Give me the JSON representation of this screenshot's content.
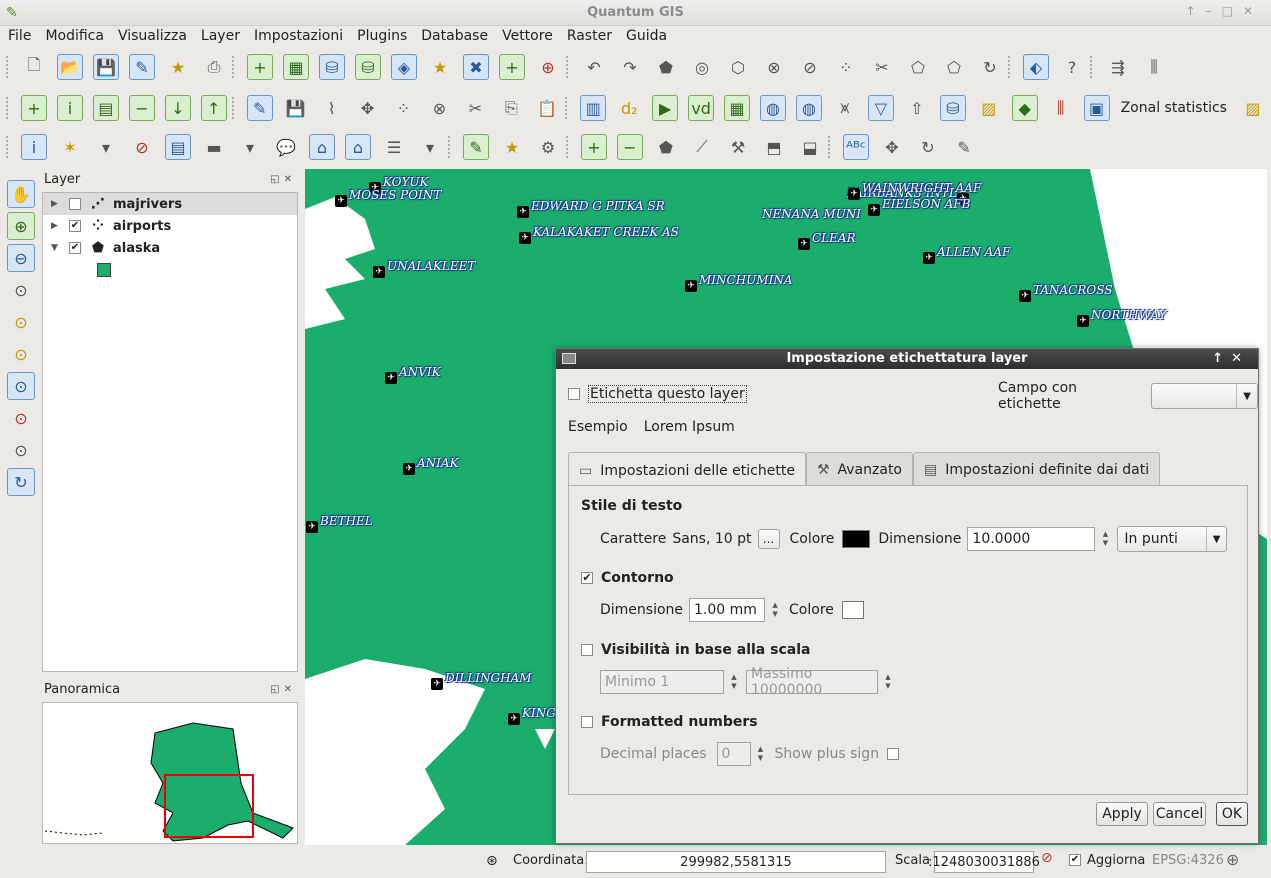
{
  "window": {
    "title": "Quantum GIS"
  },
  "menu": [
    "File",
    "Modifica",
    "Visualizza",
    "Layer",
    "Impostazioni",
    "Plugins",
    "Database",
    "Vettore",
    "Raster",
    "Guida"
  ],
  "toolbar2": {
    "zonal_label": "Zonal statistics"
  },
  "layers_panel": {
    "title": "Layer",
    "layers": [
      {
        "name": "majrivers",
        "checked": false,
        "expanded": false,
        "icon": "line-layer-icon"
      },
      {
        "name": "airports",
        "checked": true,
        "expanded": false,
        "icon": "point-layer-icon"
      },
      {
        "name": "alaska",
        "checked": true,
        "expanded": true,
        "icon": "polygon-layer-icon"
      }
    ],
    "alaska_fill": "#1aad6c"
  },
  "overview_panel": {
    "title": "Panoramica"
  },
  "map": {
    "fill": "#1aad6c",
    "airports": [
      "KOYUK",
      "MOSES POINT",
      "EDWARD G PITKA SR",
      "KALAKAKET CREEK  AS",
      "FAIRBANKS INTL",
      "WAINWRIGHT AAF",
      "EIELSON AFB",
      "NENANA MUNI",
      "CLEAR",
      "ALLEN AAF",
      "UNALAKLEET",
      "MINCHUMINA",
      "TANACROSS",
      "NORTHWAY",
      "ANVIK",
      "ANIAK",
      "BETHEL",
      "DILLINGHAM",
      "KING S"
    ]
  },
  "dialog": {
    "title": "Impostazione etichettatura layer",
    "label_layer": "Etichetta questo layer",
    "label_field": "Campo con etichette",
    "field_value": "",
    "example_label": "Esempio",
    "example_text": "Lorem Ipsum",
    "tabs": [
      "Impostazioni delle etichette",
      "Avanzato",
      "Impostazioni definite dai dati"
    ],
    "text_style": {
      "header": "Stile di testo",
      "font_label": "Carattere",
      "font_value": "Sans, 10 pt",
      "font_button": "...",
      "color_label": "Colore",
      "color_value": "#000000",
      "size_label": "Dimensione",
      "size_value": "10.0000",
      "unit": "In punti"
    },
    "outline": {
      "header": "Contorno",
      "checked": true,
      "size_label": "Dimensione",
      "size_value": "1.00 mm",
      "color_label": "Colore",
      "color_value": "#ffffff"
    },
    "scale_visibility": {
      "header": "Visibilità in base alla scala",
      "checked": false,
      "min": "Minimo 1",
      "max": "Massimo 10000000"
    },
    "formatted_numbers": {
      "header": "Formatted numbers",
      "checked": false,
      "decimal_label": "Decimal places",
      "decimal_value": "0",
      "plus_sign_label": "Show plus sign"
    },
    "buttons": {
      "apply": "Apply",
      "cancel": "Cancel",
      "ok": "OK"
    }
  },
  "status": {
    "coord_label": "Coordinata:",
    "coord_value": "299982,5581315",
    "scale_label": "Scala",
    "scale_value": ":1248030031886",
    "render_label": "Aggiorna",
    "render_checked": true,
    "crs": "EPSG:4326"
  }
}
